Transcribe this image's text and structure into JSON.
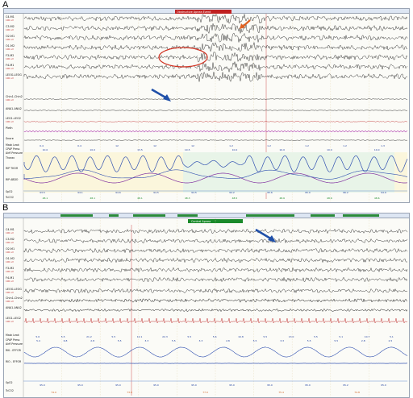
{
  "panel_a": {
    "letter": "A",
    "event_tag": "Obstructive Apnea Event",
    "channels": [
      {
        "name": "C4-M1",
        "sub": "100 uV"
      },
      {
        "name": "C3-M2",
        "sub": "100 uV"
      },
      {
        "name": "O2-M1",
        "sub": "100 uV"
      },
      {
        "name": "O1-M2",
        "sub": "100 uV"
      },
      {
        "name": "F3-M2",
        "sub": "100 uV"
      },
      {
        "name": "F4-M1",
        "sub": "100 uV"
      },
      {
        "name": "LEOG-LEOG",
        "sub": "100 uV"
      },
      {
        "name": "Chin1-Chin2",
        "sub": "100 uV"
      },
      {
        "name": "ANA1-ANA2",
        "sub": ""
      },
      {
        "name": "LEG1-LEG2",
        "sub": "100 uV"
      },
      {
        "name": "Pleth",
        "sub": ""
      },
      {
        "name": "Snore",
        "sub": ""
      },
      {
        "name": "Mask Leak",
        "sub": ""
      },
      {
        "name": "CPAP Press",
        "sub": ""
      },
      {
        "name": "Airfl Pressure",
        "sub": ""
      },
      {
        "name": "Thorax",
        "sub": ""
      },
      {
        "name": "RIP THOR",
        "sub": ""
      },
      {
        "name": "RIP ABDO",
        "sub": ""
      },
      {
        "name": "SpO2",
        "sub": ""
      },
      {
        "name": "TcCO2",
        "sub": ""
      }
    ],
    "leak_values": [
      "0.4",
      "0.4",
      "12",
      "12",
      "12",
      "1.2",
      "1.2",
      "1.2",
      "1.2",
      "1.3"
    ],
    "press_values": [
      "10.0",
      "10.0",
      "13.5",
      "10.5",
      "10.0",
      "10.0",
      "10.0",
      "10.0"
    ],
    "spo2_values": [
      "93.5",
      "94.1",
      "94.6",
      "94.5",
      "94.5",
      "94.2",
      "95.6",
      "95.0",
      "96.2",
      "94.9"
    ],
    "tcco2_values": [
      "48.1",
      "48.1",
      "48.1",
      "48.3",
      "48.5",
      "48.6",
      "48.6",
      "48.6"
    ]
  },
  "panel_b": {
    "letter": "B",
    "event_tag": "Central Apnea",
    "channels": [
      {
        "name": "C4-M1",
        "sub": "100 uV"
      },
      {
        "name": "C3-M2",
        "sub": "100 uV"
      },
      {
        "name": "O2-M1",
        "sub": "100 uV"
      },
      {
        "name": "O1-M2",
        "sub": "100 uV"
      },
      {
        "name": "F3-M2",
        "sub": "100 uV"
      },
      {
        "name": "F4-M1",
        "sub": "100 uV"
      },
      {
        "name": "LEOG-LEOG",
        "sub": "100 uV"
      },
      {
        "name": "Chin1-Chin2",
        "sub": "100 uV"
      },
      {
        "name": "ANA1-ANA2",
        "sub": "100 uV"
      },
      {
        "name": "LEG1-LEG2",
        "sub": "100 uV"
      },
      {
        "name": "Mask Leak",
        "sub": ""
      },
      {
        "name": "CPAP Press",
        "sub": ""
      },
      {
        "name": "Airfl Pressure",
        "sub": ""
      },
      {
        "name": "RIK - EFFOR",
        "sub": ""
      },
      {
        "name": "RIO - EFFOR",
        "sub": ""
      },
      {
        "name": "SpO2",
        "sub": ""
      },
      {
        "name": "TcCO2",
        "sub": ""
      }
    ],
    "leak_values": [
      "5.6",
      "5.5",
      "21.2",
      "5.5",
      "12.1",
      "22.3",
      "5.5",
      "5.6",
      "10.8",
      "5.5",
      "13.0",
      "5.5",
      "5.1",
      "10.7",
      "5.1"
    ],
    "press_values": [
      "5.4",
      "6.8",
      "2.8",
      "5.5",
      "3.3",
      "5.5",
      "3.3",
      "2.8",
      "5.5",
      "3.3",
      "5.5",
      "5.5",
      "2.8",
      "2.5"
    ],
    "spo2_values": [
      "95.0",
      "95.0",
      "95.0",
      "95.0",
      "95.0",
      "95.0",
      "95.0",
      "95.0",
      "95.2",
      "95.0"
    ],
    "tcco2_values": [
      "74.0",
      "73.8",
      "77.0",
      "75.4",
      "74.8"
    ]
  },
  "colors": {
    "eeg": "#222222",
    "emg": "#c03030",
    "resp": "#3050b0",
    "arrow": "#1f4fa8",
    "highlight": "#d03020",
    "event_a": "#c02020",
    "event_b": "#1a8a2a",
    "panel_bg": "#fbfbf7",
    "resp_region": "#e8f4e8"
  }
}
